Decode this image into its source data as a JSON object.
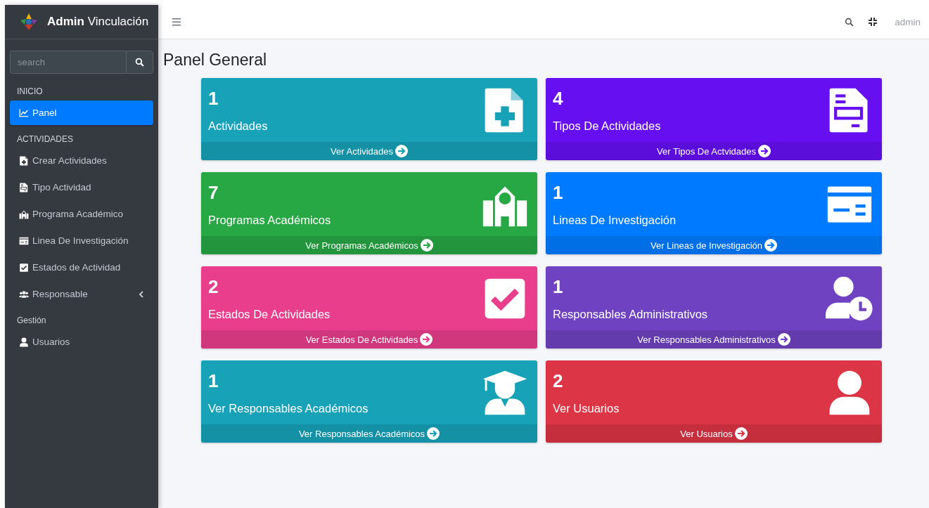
{
  "brand": {
    "title": "Admin",
    "subtitle": "Vinculación"
  },
  "sidebar": {
    "search": {
      "placeholder": "search"
    },
    "items": [
      {
        "kind": "header",
        "label": "INICIO"
      },
      {
        "kind": "link",
        "label": "Panel",
        "selected": true
      },
      {
        "kind": "header",
        "label": "ACTIVIDADES"
      },
      {
        "kind": "link",
        "label": "Crear Actividades",
        "selected": false
      },
      {
        "kind": "link",
        "label": "Tipo Actividad",
        "selected": false
      },
      {
        "kind": "link",
        "label": "Programa Académico",
        "selected": false
      },
      {
        "kind": "link",
        "label": "Linea De Investigación",
        "selected": false
      },
      {
        "kind": "link",
        "label": "Estados de Actividad",
        "selected": false
      },
      {
        "kind": "link",
        "label": "Responsable",
        "selected": false,
        "expandable": true
      },
      {
        "kind": "header",
        "label": "Gestión"
      },
      {
        "kind": "link",
        "label": "Usuarios",
        "selected": false
      }
    ]
  },
  "topbar": {
    "user": "admin"
  },
  "page_title": "Panel General",
  "cards": [
    {
      "count": "1",
      "label": "Actividades",
      "link": "Ver Actividades",
      "color": "#17a2b8"
    },
    {
      "count": "4",
      "label": "Tipos De Actividades",
      "link": "Ver Tipos De Actvidades",
      "color": "#6610f2"
    },
    {
      "count": "7",
      "label": "Programas Académicos",
      "link": "Ver Programas Académicos",
      "color": "#28a745"
    },
    {
      "count": "1",
      "label": "Lineas De Investigación",
      "link": "Ver Lineas de Investigación",
      "color": "#007bff"
    },
    {
      "count": "2",
      "label": "Estados De Actividades",
      "link": "Ver Estados De Actividades",
      "color": "#e83e8c"
    },
    {
      "count": "1",
      "label": "Responsables Administrativos",
      "link": "Ver Responsables Administrativos",
      "color": "#6f42c1"
    },
    {
      "count": "1",
      "label": "Ver Responsables Académicos",
      "link": "Ver Responsables Académicos",
      "color": "#17a2b8"
    },
    {
      "count": "2",
      "label": "Ver Usuarios",
      "link": "Ver Usuarios",
      "color": "#dc3545"
    }
  ]
}
